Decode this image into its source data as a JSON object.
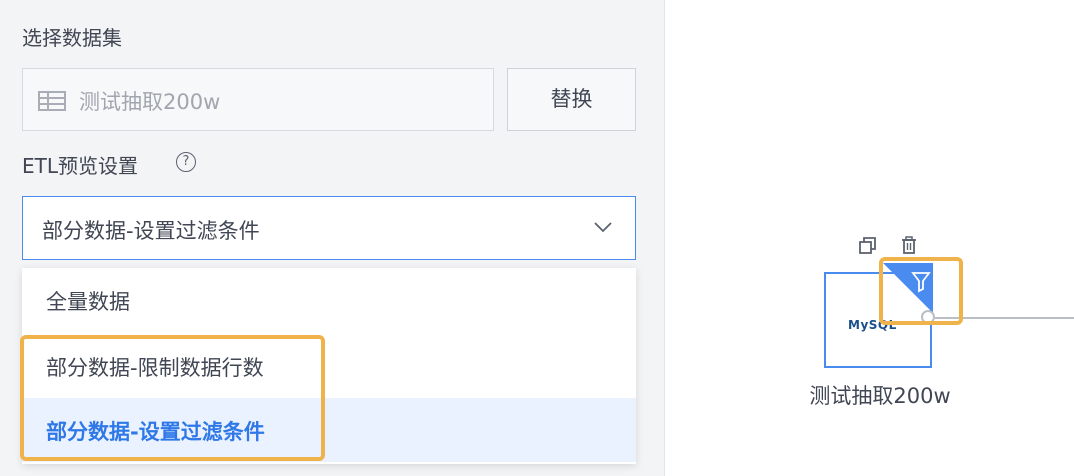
{
  "dataset": {
    "section_label": "选择数据集",
    "selected_name": "测试抽取200w",
    "replace_label": "替换"
  },
  "etl_preview": {
    "section_label": "ETL预览设置",
    "help_glyph": "?",
    "selected_value": "部分数据-设置过滤条件",
    "options": [
      {
        "label": "全量数据"
      },
      {
        "label": "部分数据-限制数据行数"
      },
      {
        "label": "部分数据-设置过滤条件",
        "selected": true
      }
    ]
  },
  "canvas": {
    "node": {
      "logo_text": "MySQL",
      "label": "测试抽取200w"
    }
  },
  "colors": {
    "accent": "#4a8bf0",
    "highlight": "#f0b24a",
    "selected_text": "#2f78e8",
    "selected_bg": "#eaf2ff"
  },
  "icons": [
    "table-icon",
    "help-icon",
    "chevron-down-icon",
    "copy-icon",
    "delete-icon",
    "filter-icon"
  ]
}
